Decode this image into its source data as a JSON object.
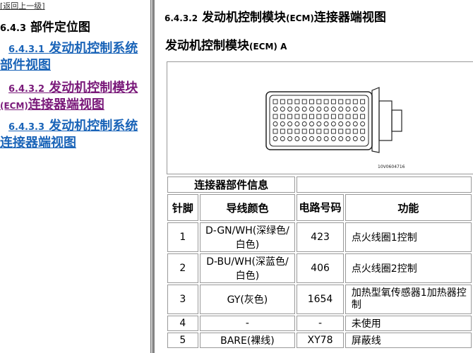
{
  "nav": {
    "back_link": "[返回上一级]",
    "heading_num": "6.4.3",
    "heading_text": "部件定位图",
    "items": [
      {
        "num": "6.4.3.1",
        "text_a": "发动机控制系统部件视图",
        "text_b": "",
        "text_c": ""
      },
      {
        "num": "6.4.3.2",
        "text_a": "发动机控制模块",
        "text_b": "(ECM)",
        "text_c": "连接器端视图"
      },
      {
        "num": "6.4.3.3",
        "text_a": "发动机控制系统连接器端视图",
        "text_b": "",
        "text_c": ""
      }
    ]
  },
  "main": {
    "title_num": "6.4.3.2",
    "title_a": "发动机控制模块",
    "title_b": "(ECM)",
    "title_c": "连接器端视图",
    "subtitle_a": "发动机控制模块",
    "subtitle_b": "(ECM) A",
    "figure_id": "10V0604716"
  },
  "table": {
    "info_header": "连接器部件信息",
    "col_pin": "针脚",
    "col_color": "导线颜色",
    "col_circuit": "电路号码",
    "col_function": "功能",
    "rows": [
      {
        "pin": "1",
        "color": "D-GN/WH(深绿色/白色)",
        "circuit": "423",
        "function": "点火线圈1控制"
      },
      {
        "pin": "2",
        "color": "D-BU/WH(深蓝色/白色)",
        "circuit": "406",
        "function": "点火线圈2控制"
      },
      {
        "pin": "3",
        "color": "GY(灰色)",
        "circuit": "1654",
        "function": "加热型氧传感器1加热器控制"
      },
      {
        "pin": "4",
        "color": "-",
        "circuit": "-",
        "function": "未使用"
      },
      {
        "pin": "5",
        "color": "BARE(裸线)",
        "circuit": "XY78",
        "function": "屏蔽线"
      }
    ]
  },
  "colors": {
    "link": "#1a64b8",
    "visited_link": "#7a1a7a",
    "border": "#999999"
  }
}
